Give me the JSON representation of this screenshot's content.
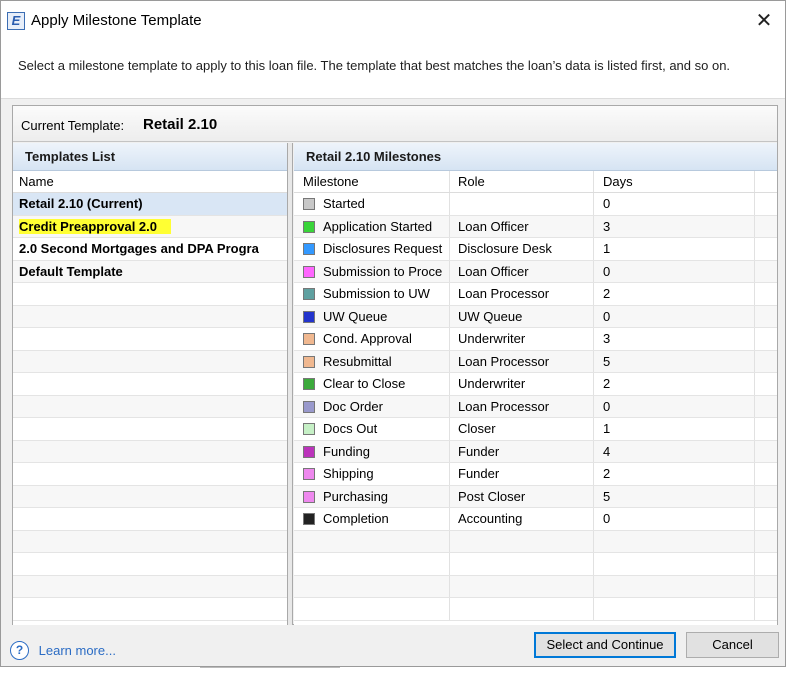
{
  "window": {
    "title": "Apply Milestone Template",
    "app_icon_letter": "E",
    "close_glyph": "✕",
    "description": "Select a milestone template to apply to this loan file. The template that best matches the loan’s data is listed first, and so on."
  },
  "current_template": {
    "label": "Current Template:",
    "value": "Retail 2.10"
  },
  "templates_list": {
    "header": "Templates List",
    "column": "Name",
    "items": [
      {
        "name": "Retail 2.10 (Current)",
        "selected": true,
        "highlighted": false
      },
      {
        "name": "Credit Preapproval 2.0",
        "selected": false,
        "highlighted": true
      },
      {
        "name": "2.0 Second Mortgages and DPA Progra",
        "selected": false,
        "highlighted": false
      },
      {
        "name": "Default Template",
        "selected": false,
        "highlighted": false
      }
    ],
    "highlight_color": "#ffff33",
    "selected_color": "#d9e6f5"
  },
  "milestones": {
    "header": "Retail 2.10 Milestones",
    "columns": [
      "Milestone",
      "Role",
      "Days"
    ],
    "rows": [
      {
        "milestone": "Started",
        "role": "",
        "days": "0",
        "color": "#c8c8c8"
      },
      {
        "milestone": "Application Started",
        "role": "Loan Officer",
        "days": "3",
        "color": "#39d439"
      },
      {
        "milestone": "Disclosures Request",
        "role": "Disclosure Desk",
        "days": "1",
        "color": "#3399ff"
      },
      {
        "milestone": "Submission to Proce",
        "role": "Loan Officer",
        "days": "0",
        "color": "#ff66ff"
      },
      {
        "milestone": "Submission to UW",
        "role": "Loan Processor",
        "days": "2",
        "color": "#5fa0a0"
      },
      {
        "milestone": "UW Queue",
        "role": "UW Queue",
        "days": "0",
        "color": "#2233cc"
      },
      {
        "milestone": "Cond. Approval",
        "role": "Underwriter",
        "days": "3",
        "color": "#f0b890"
      },
      {
        "milestone": "Resubmittal",
        "role": "Loan Processor",
        "days": "5",
        "color": "#f0b890"
      },
      {
        "milestone": "Clear to Close",
        "role": "Underwriter",
        "days": "2",
        "color": "#3caa3c"
      },
      {
        "milestone": "Doc Order",
        "role": "Loan Processor",
        "days": "0",
        "color": "#9999cc"
      },
      {
        "milestone": "Docs Out",
        "role": "Closer",
        "days": "1",
        "color": "#c6f0c6"
      },
      {
        "milestone": "Funding",
        "role": "Funder",
        "days": "4",
        "color": "#bb33bb"
      },
      {
        "milestone": "Shipping",
        "role": "Funder",
        "days": "2",
        "color": "#ee88ee"
      },
      {
        "milestone": "Purchasing",
        "role": "Post Closer",
        "days": "5",
        "color": "#ee88ee"
      },
      {
        "milestone": "Completion",
        "role": "Accounting",
        "days": "0",
        "color": "#222222"
      }
    ]
  },
  "footer": {
    "help_glyph": "?",
    "learn_more": "Learn more...",
    "select_button": "Select and Continue",
    "cancel_button": "Cancel"
  }
}
